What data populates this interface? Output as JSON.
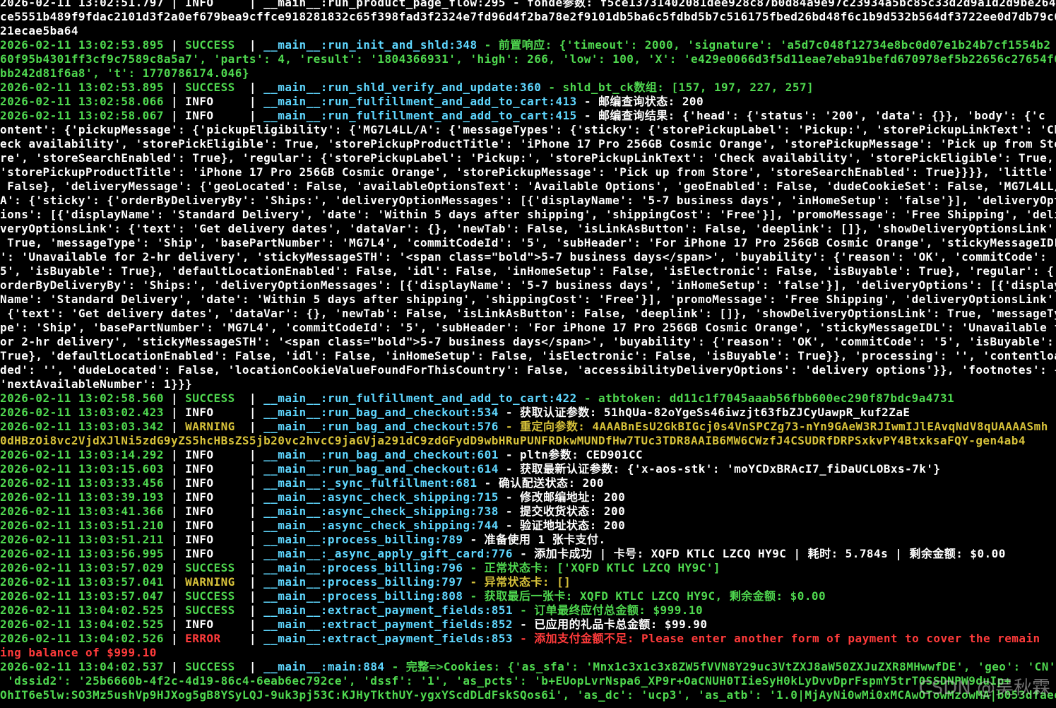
{
  "terminal": {
    "lines": [
      {
        "type": "cont",
        "color": "white",
        "text": "2026-02-11 13:02:51.797 | INFO     | __main__:run_product_page_flow:295 - fonde参数: f5ce13731402081dee928c87b0d84a9e97c23934a5bc85c33d2d9a1d2d9be264"
      },
      {
        "type": "cont",
        "color": "white",
        "text": "ce5551b489f9fdac2101d3f2a0ef679bea9cffce918281832c65f398fad3f2324e7fd96d4f2ba78e2f9101db5ba6c5fdbd5b7c516175fbed26bd48f6c1b9d532b564df3722ee0d7db79c6"
      },
      {
        "type": "cont",
        "color": "white",
        "text": "21ecae5ba64"
      },
      {
        "type": "log",
        "ts": "2026-02-11 13:02:53.895",
        "level": "SUCCESS",
        "level_pad": "SUCCESS  ",
        "mod": "__main__:run_init_and_shld:348",
        "msg": " - 前置响应: {'timeout': 2000, 'signature': 'a5d7c048f12734e8bc0d07e1b24b7cf1554b2"
      },
      {
        "type": "cont",
        "color": "green",
        "text": "60f95b4301ff3cf9c7589c8a5a7', 'parts': 4, 'result': '1804366931', 'high': 266, 'low': 100, 'X': 'e429e0066d3f5d11eae7eba91befd670978ef5b22656c27654f0"
      },
      {
        "type": "cont",
        "color": "green",
        "text": "bb242d81f6a8', 't': 1770786174.046}"
      },
      {
        "type": "log",
        "ts": "2026-02-11 13:02:53.895",
        "level": "SUCCESS",
        "level_pad": "SUCCESS  ",
        "mod": "__main__:run_shld_verify_and_update:360",
        "msg": " - shld_bt_ck数组: [157, 197, 227, 257]"
      },
      {
        "type": "log",
        "ts": "2026-02-11 13:02:58.066",
        "level": "INFO",
        "level_pad": "INFO     ",
        "mod": "__main__:run_fulfillment_and_add_to_cart:413",
        "msg": " - 邮编查询状态: 200"
      },
      {
        "type": "log",
        "ts": "2026-02-11 13:02:58.067",
        "level": "INFO",
        "level_pad": "INFO     ",
        "mod": "__main__:run_fulfillment_and_add_to_cart:415",
        "msg": " - 邮编查询结果: {'head': {'status': '200', 'data': {}}, 'body': {'c"
      },
      {
        "type": "cont",
        "color": "white",
        "text": "ontent': {'pickupMessage': {'pickupEligibility': {'MG7L4LL/A': {'messageTypes': {'sticky': {'storePickupLabel': 'Pickup:', 'storePickupLinkText': 'Ch"
      },
      {
        "type": "cont",
        "color": "white",
        "text": "eck availability', 'storePickEligible': True, 'storePickupProductTitle': 'iPhone 17 Pro 256GB Cosmic Orange', 'storePickupMessage': 'Pick up from Sto"
      },
      {
        "type": "cont",
        "color": "white",
        "text": "re', 'storeSearchEnabled': True}, 'regular': {'storePickupLabel': 'Pickup:', 'storePickupLinkText': 'Check availability', 'storePickEligible': True,"
      },
      {
        "type": "cont",
        "color": "white",
        "text": "'storePickupProductTitle': 'iPhone 17 Pro 256GB Cosmic Orange', 'storePickupMessage': 'Pick up from Store', 'storeSearchEnabled': True}}}}, 'little':"
      },
      {
        "type": "cont",
        "color": "white",
        "text": " False}, 'deliveryMessage': {'geoLocated': False, 'availableOptionsText': 'Available Options', 'geoEnabled': False, 'dudeCookieSet': False, 'MG7L4LL/"
      },
      {
        "type": "cont",
        "color": "white",
        "text": "A': {'sticky': {'orderByDeliveryBy': 'Ships:', 'deliveryOptionMessages': [{'displayName': '5-7 business days', 'inHomeSetup': 'false'}], 'deliveryOpt"
      },
      {
        "type": "cont",
        "color": "white",
        "text": "ions': [{'displayName': 'Standard Delivery', 'date': 'Within 5 days after shipping', 'shippingCost': 'Free'}], 'promoMessage': 'Free Shipping', 'deli"
      },
      {
        "type": "cont",
        "color": "white",
        "text": "veryOptionsLink': {'text': 'Get delivery dates', 'dataVar': {}, 'newTab': False, 'isLinkAsButton': False, 'deeplink': []}, 'showDeliveryOptionsLink':"
      },
      {
        "type": "cont",
        "color": "white",
        "text": " True, 'messageType': 'Ship', 'basePartNumber': 'MG7L4', 'commitCodeId': '5', 'subHeader': 'For iPhone 17 Pro 256GB Cosmic Orange', 'stickyMessageIDL"
      },
      {
        "type": "cont",
        "color": "white",
        "text": "': 'Unavailable for 2-hr delivery', 'stickyMessageSTH': '<span class=\"bold\">5-7 business days</span>', 'buyability': {'reason': 'OK', 'commitCode': '"
      },
      {
        "type": "cont",
        "color": "white",
        "text": "5', 'isBuyable': True}, 'defaultLocationEnabled': False, 'idl': False, 'inHomeSetup': False, 'isElectronic': False, 'isBuyable': True}, 'regular': {'"
      },
      {
        "type": "cont",
        "color": "white",
        "text": "orderByDeliveryBy': 'Ships:', 'deliveryOptionMessages': [{'displayName': '5-7 business days', 'inHomeSetup': 'false'}], 'deliveryOptions': [{'display"
      },
      {
        "type": "cont",
        "color": "white",
        "text": "Name': 'Standard Delivery', 'date': 'Within 5 days after shipping', 'shippingCost': 'Free'}], 'promoMessage': 'Free Shipping', 'deliveryOptionsLink':"
      },
      {
        "type": "cont",
        "color": "white",
        "text": " {'text': 'Get delivery dates', 'dataVar': {}, 'newTab': False, 'isLinkAsButton': False, 'deeplink': []}, 'showDeliveryOptionsLink': True, 'messageTy"
      },
      {
        "type": "cont",
        "color": "white",
        "text": "pe': 'Ship', 'basePartNumber': 'MG7L4', 'commitCodeId': '5', 'subHeader': 'For iPhone 17 Pro 256GB Cosmic Orange', 'stickyMessageIDL': 'Unavailable f"
      },
      {
        "type": "cont",
        "color": "white",
        "text": "or 2-hr delivery', 'stickyMessageSTH': '<span class=\"bold\">5-7 business days</span>', 'buyability': {'reason': 'OK', 'commitCode': '5', 'isBuyable':"
      },
      {
        "type": "cont",
        "color": "white",
        "text": "True}, 'defaultLocationEnabled': False, 'idl': False, 'inHomeSetup': False, 'isElectronic': False, 'isBuyable': True}}, 'processing': '', 'contentloa"
      },
      {
        "type": "cont",
        "color": "white",
        "text": "ded': '', 'dudeLocated': False, 'locationCookieValueFoundForThisCountry': False, 'accessibilityDeliveryOptions': 'delivery options'}}, 'footnotes': {"
      },
      {
        "type": "cont",
        "color": "white",
        "text": "'nextAvailableNumber': 1}}}"
      },
      {
        "type": "log",
        "ts": "2026-02-11 13:02:58.560",
        "level": "SUCCESS",
        "level_pad": "SUCCESS  ",
        "mod": "__main__:run_fulfillment_and_add_to_cart:422",
        "msg": " - atbtoken: dd11c1f7045aaab56fbb600ec290f87bdc9a4731"
      },
      {
        "type": "log",
        "ts": "2026-02-11 13:03:02.423",
        "level": "INFO",
        "level_pad": "INFO     ",
        "mod": "__main__:run_bag_and_checkout:534",
        "msg": " - 获取认证参数: 51hQUa-82oYgeSs46iwzjt63fbZJCyUawpR_kuf2ZaE"
      },
      {
        "type": "log",
        "ts": "2026-02-11 13:03:03.342",
        "level": "WARNING",
        "level_pad": "WARNING  ",
        "mod": "__main__:run_bag_and_checkout:576",
        "msg": " - 重定向参数: 4AAABnEsU2GkBIGcj0s4VnSPCZg73-nYn9GAeW3RJIwmIJlEAvqNdV8qUAAAASmh"
      },
      {
        "type": "cont",
        "color": "yellow",
        "text": "0dHBzOi8vc2VjdXJlNi5zdG9yZS5hcHBsZS5jb20vc2hvcC9jaGVja291dC9zdGFydD9wbHRuPUNFRDkwMUNDfHw7TUc3TDR8AAIB6MW6CWzfJ4CSUDRfDRPSxkvPY4BtxksaFQY-gen4ab4"
      },
      {
        "type": "log",
        "ts": "2026-02-11 13:03:14.292",
        "level": "INFO",
        "level_pad": "INFO     ",
        "mod": "__main__:run_bag_and_checkout:601",
        "msg": " - pltn参数: CED901CC"
      },
      {
        "type": "log",
        "ts": "2026-02-11 13:03:15.603",
        "level": "INFO",
        "level_pad": "INFO     ",
        "mod": "__main__:run_bag_and_checkout:614",
        "msg": " - 获取最新认证参数: {'x-aos-stk': 'moYCDxBRAcI7_fiDaUCLOBxs-7k'}"
      },
      {
        "type": "log",
        "ts": "2026-02-11 13:03:33.456",
        "level": "INFO",
        "level_pad": "INFO     ",
        "mod": "__main__:_sync_fulfillment:681",
        "msg": " - 确认配送状态: 200"
      },
      {
        "type": "log",
        "ts": "2026-02-11 13:03:39.193",
        "level": "INFO",
        "level_pad": "INFO     ",
        "mod": "__main__:async_check_shipping:715",
        "msg": " - 修改邮编地址: 200"
      },
      {
        "type": "log",
        "ts": "2026-02-11 13:03:41.366",
        "level": "INFO",
        "level_pad": "INFO     ",
        "mod": "__main__:async_check_shipping:738",
        "msg": " - 提交收货状态: 200"
      },
      {
        "type": "log",
        "ts": "2026-02-11 13:03:51.210",
        "level": "INFO",
        "level_pad": "INFO     ",
        "mod": "__main__:async_check_shipping:744",
        "msg": " - 验证地址状态: 200"
      },
      {
        "type": "log",
        "ts": "2026-02-11 13:03:51.211",
        "level": "INFO",
        "level_pad": "INFO     ",
        "mod": "__main__:process_billing:789",
        "msg": " - 准备使用 1 张卡支付."
      },
      {
        "type": "log",
        "ts": "2026-02-11 13:03:56.995",
        "level": "INFO",
        "level_pad": "INFO     ",
        "mod": "__main__:_async_apply_gift_card:776",
        "msg": " - 添加卡成功 | 卡号: XQFD KTLC LZCQ HY9C | 耗时: 5.784s | 剩余金额: $0.00"
      },
      {
        "type": "log",
        "ts": "2026-02-11 13:03:57.029",
        "level": "SUCCESS",
        "level_pad": "SUCCESS  ",
        "mod": "__main__:process_billing:796",
        "msg": " - 正常状态卡: ['XQFD KTLC LZCQ HY9C']"
      },
      {
        "type": "log",
        "ts": "2026-02-11 13:03:57.041",
        "level": "WARNING",
        "level_pad": "WARNING  ",
        "mod": "__main__:process_billing:797",
        "msg": " - 异常状态卡: []"
      },
      {
        "type": "log",
        "ts": "2026-02-11 13:03:57.047",
        "level": "SUCCESS",
        "level_pad": "SUCCESS  ",
        "mod": "__main__:process_billing:808",
        "msg": " - 获取最后一张卡: XQFD KTLC LZCQ HY9C, 剩余金额: $0.00"
      },
      {
        "type": "log",
        "ts": "2026-02-11 13:04:02.525",
        "level": "SUCCESS",
        "level_pad": "SUCCESS  ",
        "mod": "__main__:extract_payment_fields:851",
        "msg": " - 订单最终应付总金额: $999.10"
      },
      {
        "type": "log",
        "ts": "2026-02-11 13:04:02.525",
        "level": "INFO",
        "level_pad": "INFO     ",
        "mod": "__main__:extract_payment_fields:852",
        "msg": " - 已应用的礼品卡总金额: $99.90"
      },
      {
        "type": "log",
        "ts": "2026-02-11 13:04:02.526",
        "level": "ERROR",
        "level_pad": "ERROR    ",
        "mod": "__main__:extract_payment_fields:853",
        "msg": " - 添加支付金额不足: Please enter another form of payment to cover the remain"
      },
      {
        "type": "cont",
        "color": "red",
        "text": "ing balance of $999.10"
      },
      {
        "type": "log",
        "ts": "2026-02-11 13:04:02.537",
        "level": "SUCCESS",
        "level_pad": "SUCCESS  ",
        "mod": "__main__:main:884",
        "msg": " - 完整=>Cookies: {'as_sfa': 'Mnx1c3x1c3x8ZW5fVVN8Y29uc3VtZXJ8aW50ZXJuZXR8MHwwfDE', 'geo': 'CN'"
      },
      {
        "type": "cont",
        "color": "green",
        "text": " 'dssid2': '25b6660b-4f2c-4d19-86c4-6eab6ec792ce', 'dssf': '1', 'as_pcts': 'b+EUopLvrNspa6_XP9r+OaCNUH0TIieSyH0kLyDvvDprFspmY5trT0SSDNPW9duIp+"
      },
      {
        "type": "cont",
        "color": "green",
        "text": "OhIT6e5lw:SO3Mz5ushVp9HJXog5gB8YSyLQJ-9uk3pj53C:KJHyTkthUY-ygxYScdDLdFskSQos6i', 'as_dc': 'ucp3', 'as_atb': '1.0|MjAyNi0wMi0xMCAwOTowMzowMA|b053dfaeeb"
      }
    ]
  },
  "watermark": "CSDN @吴秋霖",
  "colors": {
    "background": "#000000",
    "timestamp": "#4fd84f",
    "module": "#5fd7ff",
    "info": "#ffffff",
    "success": "#4fd84f",
    "warning": "#d7c23a",
    "error": "#ff3b3b"
  }
}
